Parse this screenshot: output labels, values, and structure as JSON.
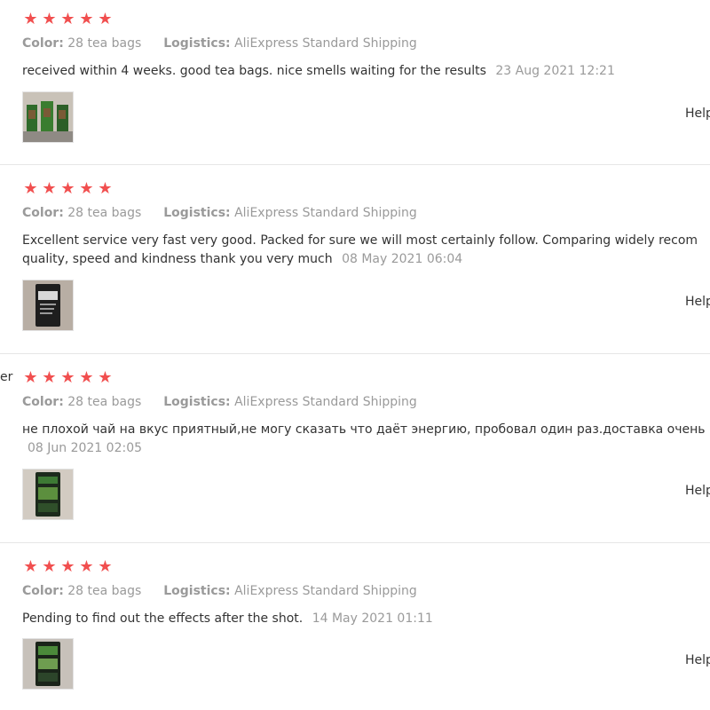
{
  "labels": {
    "color_key": "Color:",
    "logistics_key": "Logistics:",
    "helpful": "Help",
    "star": "★"
  },
  "reviews": [
    {
      "color": "28 tea bags",
      "logistics": "AliExpress Standard Shipping",
      "text_lines": [
        "received within 4 weeks. good tea bags. nice smells waiting for the results"
      ],
      "date": "23 Aug 2021 12:21",
      "rating": 5
    },
    {
      "color": "28 tea bags",
      "logistics": "AliExpress Standard Shipping",
      "text_lines": [
        "Excellent service very fast very good. Packed for sure we will most certainly follow. Comparing widely recom",
        "quality, speed and kindness thank you very much"
      ],
      "date": "08 May 2021 06:04",
      "rating": 5
    },
    {
      "reviewer_fragment": "er",
      "color": "28 tea bags",
      "logistics": "AliExpress Standard Shipping",
      "text_lines": [
        "не плохой чай на вкус приятный,не могу сказать что даёт энергию, пробовал один раз.доставка очень",
        ""
      ],
      "date": "08 Jun 2021 02:05",
      "rating": 5
    },
    {
      "color": "28 tea bags",
      "logistics": "AliExpress Standard Shipping",
      "text_lines": [
        "Pending to find out the effects after the shot."
      ],
      "date": "14 May 2021 01:11",
      "rating": 5
    }
  ],
  "colors": {
    "star": "#f14f4f",
    "muted": "#9a9a9a",
    "text": "#333333",
    "divider": "#e6e6e6"
  }
}
